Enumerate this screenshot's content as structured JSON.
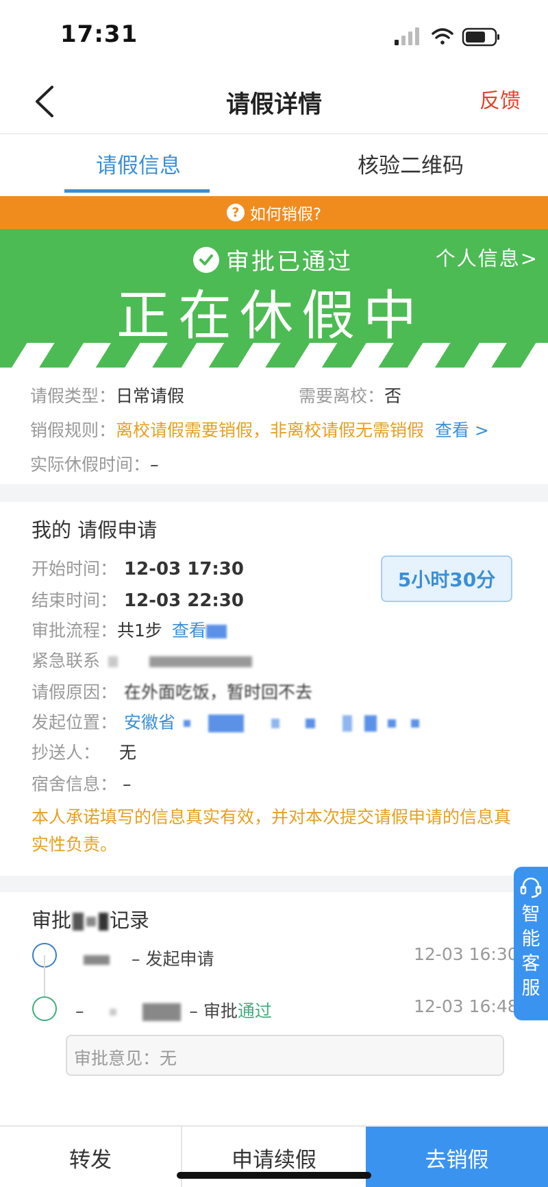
{
  "status_bar": {
    "time": "17:31"
  },
  "nav": {
    "title": "请假详情",
    "feedback": "反馈"
  },
  "tabs": [
    {
      "label": "请假信息"
    },
    {
      "label": "核验二维码"
    }
  ],
  "howto": {
    "label": "如何销假?"
  },
  "banner": {
    "approved": "审批已通过",
    "personal_info": "个人信息>",
    "status": "正在休假中"
  },
  "info": {
    "leave_type_label": "请假类型：",
    "leave_type_value": "日常请假",
    "need_leave_school_label": "需要离校：",
    "need_leave_school_value": "否",
    "cancel_rule_label": "销假规则：",
    "cancel_rule_value": "离校请假需要销假，非离校请假无需销假",
    "cancel_rule_link": "查看 >",
    "actual_time_label": "实际休假时间：",
    "actual_time_value": "–"
  },
  "application": {
    "title": "我的 请假申请",
    "duration": "5小时30分",
    "start_label": "开始时间：",
    "start_value": "12-03 17:30",
    "end_label": "结束时间：",
    "end_value": "12-03 22:30",
    "flow_label": "审批流程：",
    "flow_value": "共1步",
    "flow_link": "查看",
    "contact_label": "紧急联系",
    "reason_label": "请假原因：",
    "reason_value": "在外面吃饭，暂时回不去",
    "location_label": "发起位置：",
    "location_value": "安徽省",
    "cc_label": "抄送人：",
    "cc_value": "无",
    "dorm_label": "宿舍信息：",
    "dorm_value": "–",
    "promise": "本人承诺填写的信息真实有效，并对本次提交请假申请的信息真实性负责。"
  },
  "records": {
    "title_prefix": "审批",
    "title_suffix": "记录",
    "items": [
      {
        "text": "– 发起申请",
        "time": "12-03 16:30"
      },
      {
        "text_prefix": "– 审批",
        "status": "通过",
        "time": "12-03 16:48"
      }
    ],
    "opinion": "审批意见：无"
  },
  "service": {
    "label": "智能客服"
  },
  "bottom": {
    "forward": "转发",
    "extend": "申请续假",
    "cancel": "去销假"
  },
  "colors": {
    "accent_blue": "#3b8fd6",
    "banner_green": "#4cbb53",
    "orange": "#f08c1e",
    "warning_text": "#e5a020",
    "feedback_red": "#e6412c"
  }
}
